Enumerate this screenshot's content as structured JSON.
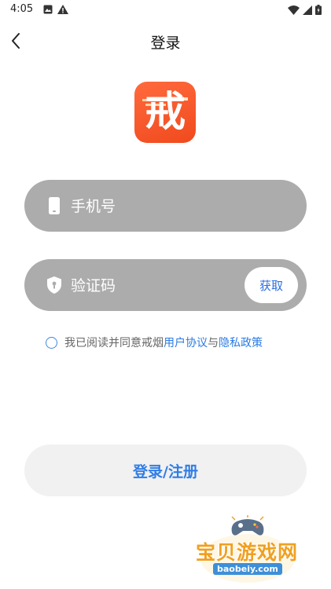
{
  "status_bar": {
    "time": "4:05"
  },
  "header": {
    "title": "登录"
  },
  "logo": {
    "char": "戒"
  },
  "phone_field": {
    "placeholder": "手机号"
  },
  "code_field": {
    "placeholder": "验证码",
    "get_code_label": "获取"
  },
  "agreement": {
    "prefix": "我已阅读并同意戒烟",
    "user_agreement": "用户协议",
    "conjunction": "与",
    "privacy_policy": "隐私政策"
  },
  "submit": {
    "label": "登录/注册"
  },
  "watermark": {
    "title": "宝贝游戏网",
    "url": "baobeiy.com"
  },
  "colors": {
    "accent": "#2a7be4",
    "field_bg": "#acacac",
    "logo_bg": "#f04a1e",
    "submit_bg": "#f1f1f1"
  }
}
